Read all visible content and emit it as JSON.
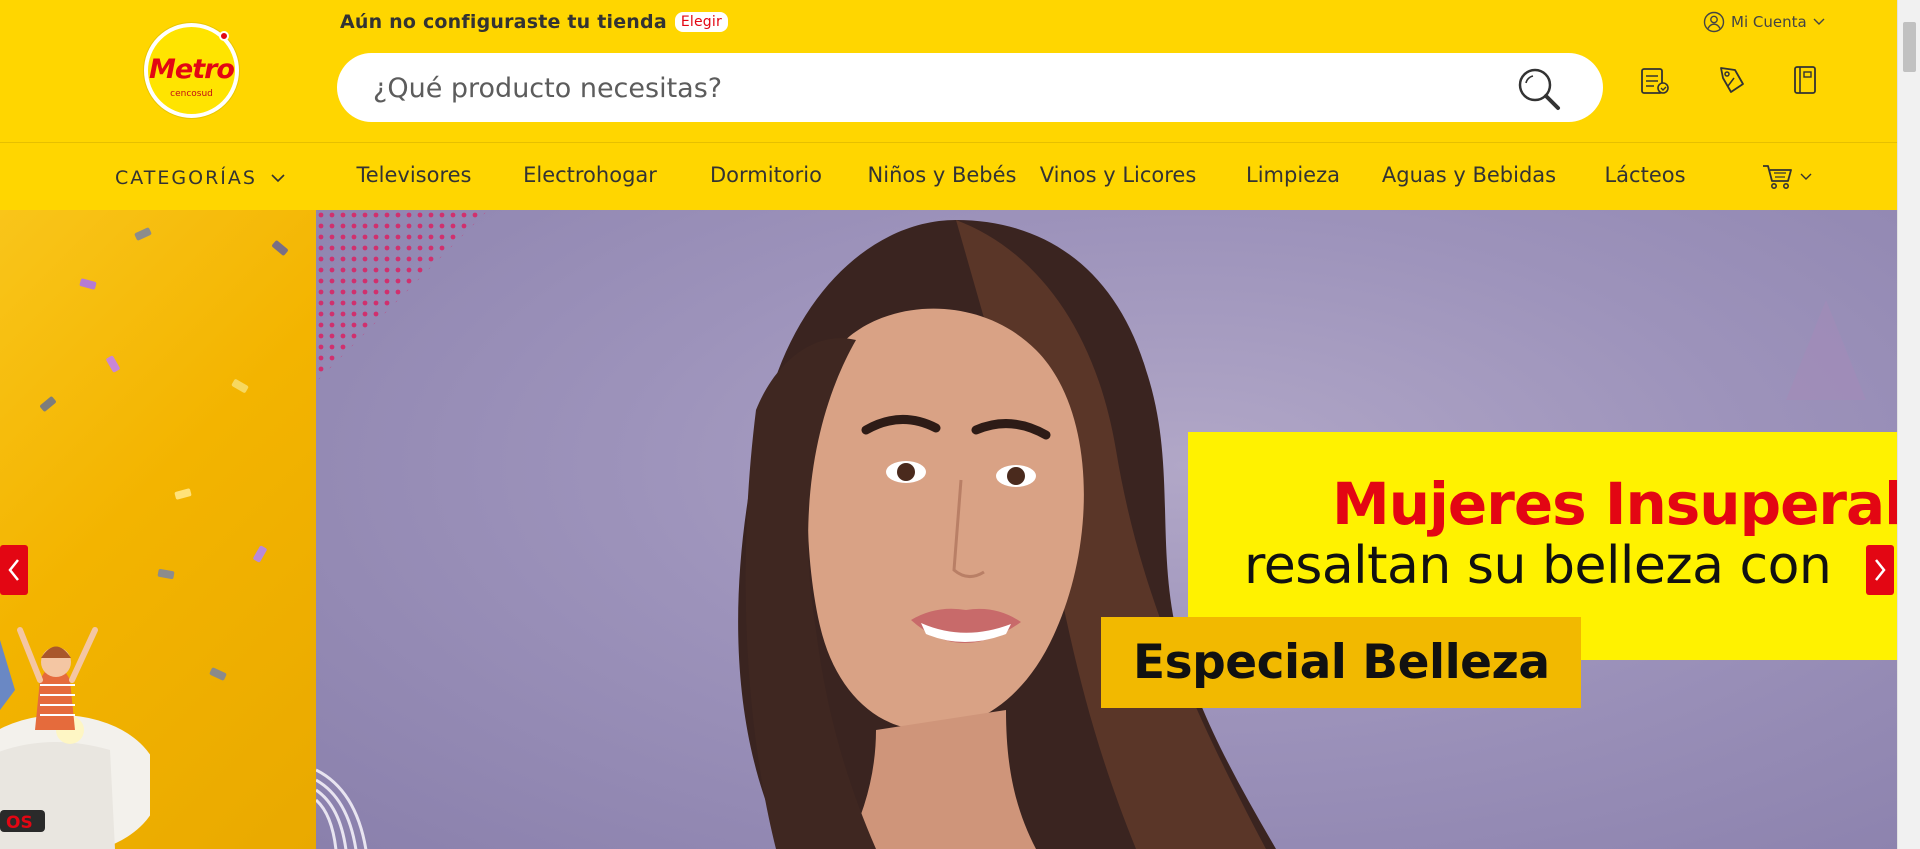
{
  "header": {
    "logo_text": "Metro",
    "logo_sub": "cencosud",
    "notice_text": "Aún no configuraste tu tienda",
    "notice_link": "Elegir",
    "account_label": "Mi Cuenta",
    "search_placeholder": "¿Qué producto necesitas?",
    "icons": [
      "search-icon",
      "shopping-list-icon",
      "coupon-icon",
      "catalog-icon",
      "user-icon",
      "cart-icon"
    ]
  },
  "nav": {
    "categories_label": "CATEGORÍAS",
    "items": [
      "Televisores",
      "Electrohogar",
      "Dormitorio",
      "Niños y Bebés",
      "Vinos y Licores",
      "Limpieza",
      "Aguas y Bebidas",
      "Lácteos"
    ]
  },
  "banner": {
    "prev_slide_text": "OS",
    "promo_title": "Mujeres Insuperab",
    "promo_subtitle": "resaltan su belleza con",
    "promo_tag": "Especial Belleza"
  },
  "colors": {
    "brand_yellow": "#ffd600",
    "brand_red": "#e30613",
    "promo_yellow": "#fff200",
    "promo_orange": "#f2b900",
    "banner_purple": "#9d93bb"
  }
}
